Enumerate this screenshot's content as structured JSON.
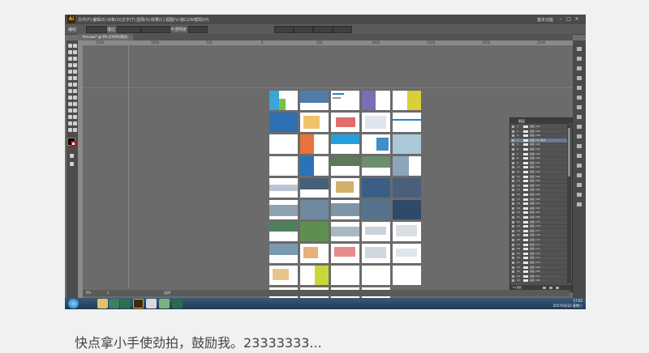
{
  "app": {
    "logo": "Ai",
    "workspace": "基本功能",
    "minimize": "–",
    "maximize": "□",
    "close": "×"
  },
  "menus": [
    "文件(F)",
    "编辑(E)",
    "对象(O)",
    "文字(T)",
    "选择(S)",
    "效果(C)",
    "视图(V)",
    "窗口(W)",
    "帮助(H)"
  ],
  "controlbar": {
    "selection_label": "编组",
    "stroke_label": "描边",
    "opacity_label": "不透明度"
  },
  "document_tab": "Preview* @ 9% (CMYK/预览)",
  "ruler_ticks": [
    "1500",
    "1000",
    "500",
    "0",
    "500",
    "1000",
    "1500",
    "2000",
    "2500"
  ],
  "layers_panel": {
    "title": "图层",
    "rows": [
      {
        "num": "1",
        "name": "画板 200"
      },
      {
        "num": "2",
        "name": "画板 199"
      },
      {
        "num": "3",
        "name": "画板 198"
      },
      {
        "num": "4",
        "name": "画板 197 副本"
      },
      {
        "num": "5",
        "name": "画板 196"
      },
      {
        "num": "6",
        "name": "画板 195"
      },
      {
        "num": "7",
        "name": "画板 194"
      },
      {
        "num": "8",
        "name": "画板 193"
      },
      {
        "num": "9",
        "name": "画板 192"
      },
      {
        "num": "10",
        "name": "画板 191"
      },
      {
        "num": "11",
        "name": "画板 190"
      },
      {
        "num": "12",
        "name": "画板 189"
      },
      {
        "num": "13",
        "name": "画板 188"
      },
      {
        "num": "14",
        "name": "画板 187"
      },
      {
        "num": "15",
        "name": "画板 186"
      },
      {
        "num": "16",
        "name": "画板 185"
      },
      {
        "num": "17",
        "name": "画板 184"
      },
      {
        "num": "18",
        "name": "画板 183"
      },
      {
        "num": "19",
        "name": "画板 182"
      },
      {
        "num": "20",
        "name": "画板 181"
      },
      {
        "num": "21",
        "name": "画板 180"
      },
      {
        "num": "22",
        "name": "画板 179"
      },
      {
        "num": "23",
        "name": "画板 178"
      },
      {
        "num": "24",
        "name": "画板 177"
      },
      {
        "num": "25",
        "name": "画板 176"
      },
      {
        "num": "26",
        "name": "画板 175"
      },
      {
        "num": "27",
        "name": "画板 174"
      },
      {
        "num": "28",
        "name": "画板 173"
      },
      {
        "num": "29",
        "name": "画板 172"
      },
      {
        "num": "30",
        "name": "画板 171"
      },
      {
        "num": "31",
        "name": "画板 170"
      },
      {
        "num": "32",
        "name": "画板 169"
      },
      {
        "num": "33",
        "name": "画板 168"
      },
      {
        "num": "34",
        "name": "画板 167"
      },
      {
        "num": "35",
        "name": "画板 166"
      }
    ],
    "footer": "64 图层"
  },
  "statusbar": {
    "zoom": "9%",
    "artboard": "1",
    "tool": "选择"
  },
  "taskbar": {
    "time": "17:02",
    "date": "2017/02/22 星期三"
  },
  "caption": "快点拿小手使劲拍，鼓励我。23333333..."
}
